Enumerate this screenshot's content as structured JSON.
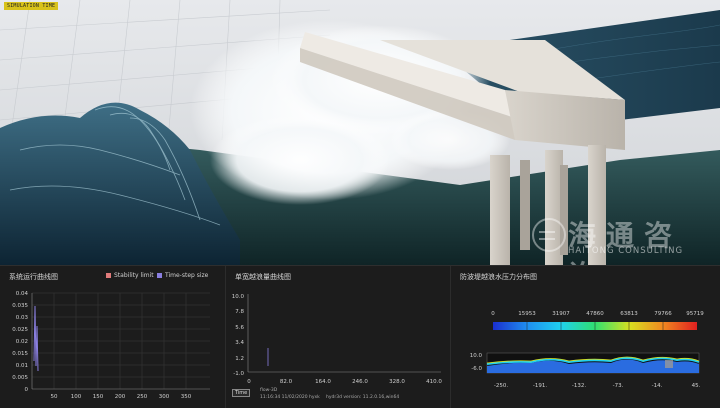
{
  "scene": {
    "sim_badge": "SIMULATION TIME",
    "watermark_cn": "海通咨询",
    "watermark_en": "HAITONG CONSULTING"
  },
  "panel1": {
    "title": "系统运行曲线图",
    "legend": [
      {
        "label": "Stability limit",
        "color": "#e07b7b"
      },
      {
        "label": "Time-step  size",
        "color": "#8a7fe0"
      }
    ],
    "y_ticks": [
      "0.04",
      "0.035",
      "0.03",
      "0.025",
      "0.02",
      "0.015",
      "0.01",
      "0.005",
      "0"
    ],
    "x_ticks": [
      "50",
      "100",
      "150",
      "200",
      "250",
      "300",
      "350"
    ]
  },
  "panel2": {
    "title": "单宽越浪量曲线图",
    "y_ticks": [
      "10.0",
      "7.8",
      "5.6",
      "3.4",
      "1.2",
      "-1.0"
    ],
    "x_ticks": [
      "0",
      "82.0",
      "164.0",
      "246.0",
      "328.0",
      "410.0"
    ],
    "time_button": "Time",
    "footer_app": "flow-3D",
    "footer_datetime": "11:16:34  11/02/2020  hyxk",
    "footer_version": "hydr3d version: 11.2.0.16,win64"
  },
  "panel3": {
    "title": "防波堤越浪水压力分布图",
    "colorbar_labels": [
      "0",
      "15953",
      "31907",
      "47860",
      "63813",
      "79766",
      "95719"
    ],
    "y_labels": [
      "10.0",
      "-6.0"
    ],
    "x_labels": [
      "-250.",
      "-191.",
      "-132.",
      "-73.",
      "-14.",
      "45."
    ]
  },
  "colors": {
    "accent_cyan": "#1fd0f0",
    "series_purple": "#8a7fe0"
  }
}
